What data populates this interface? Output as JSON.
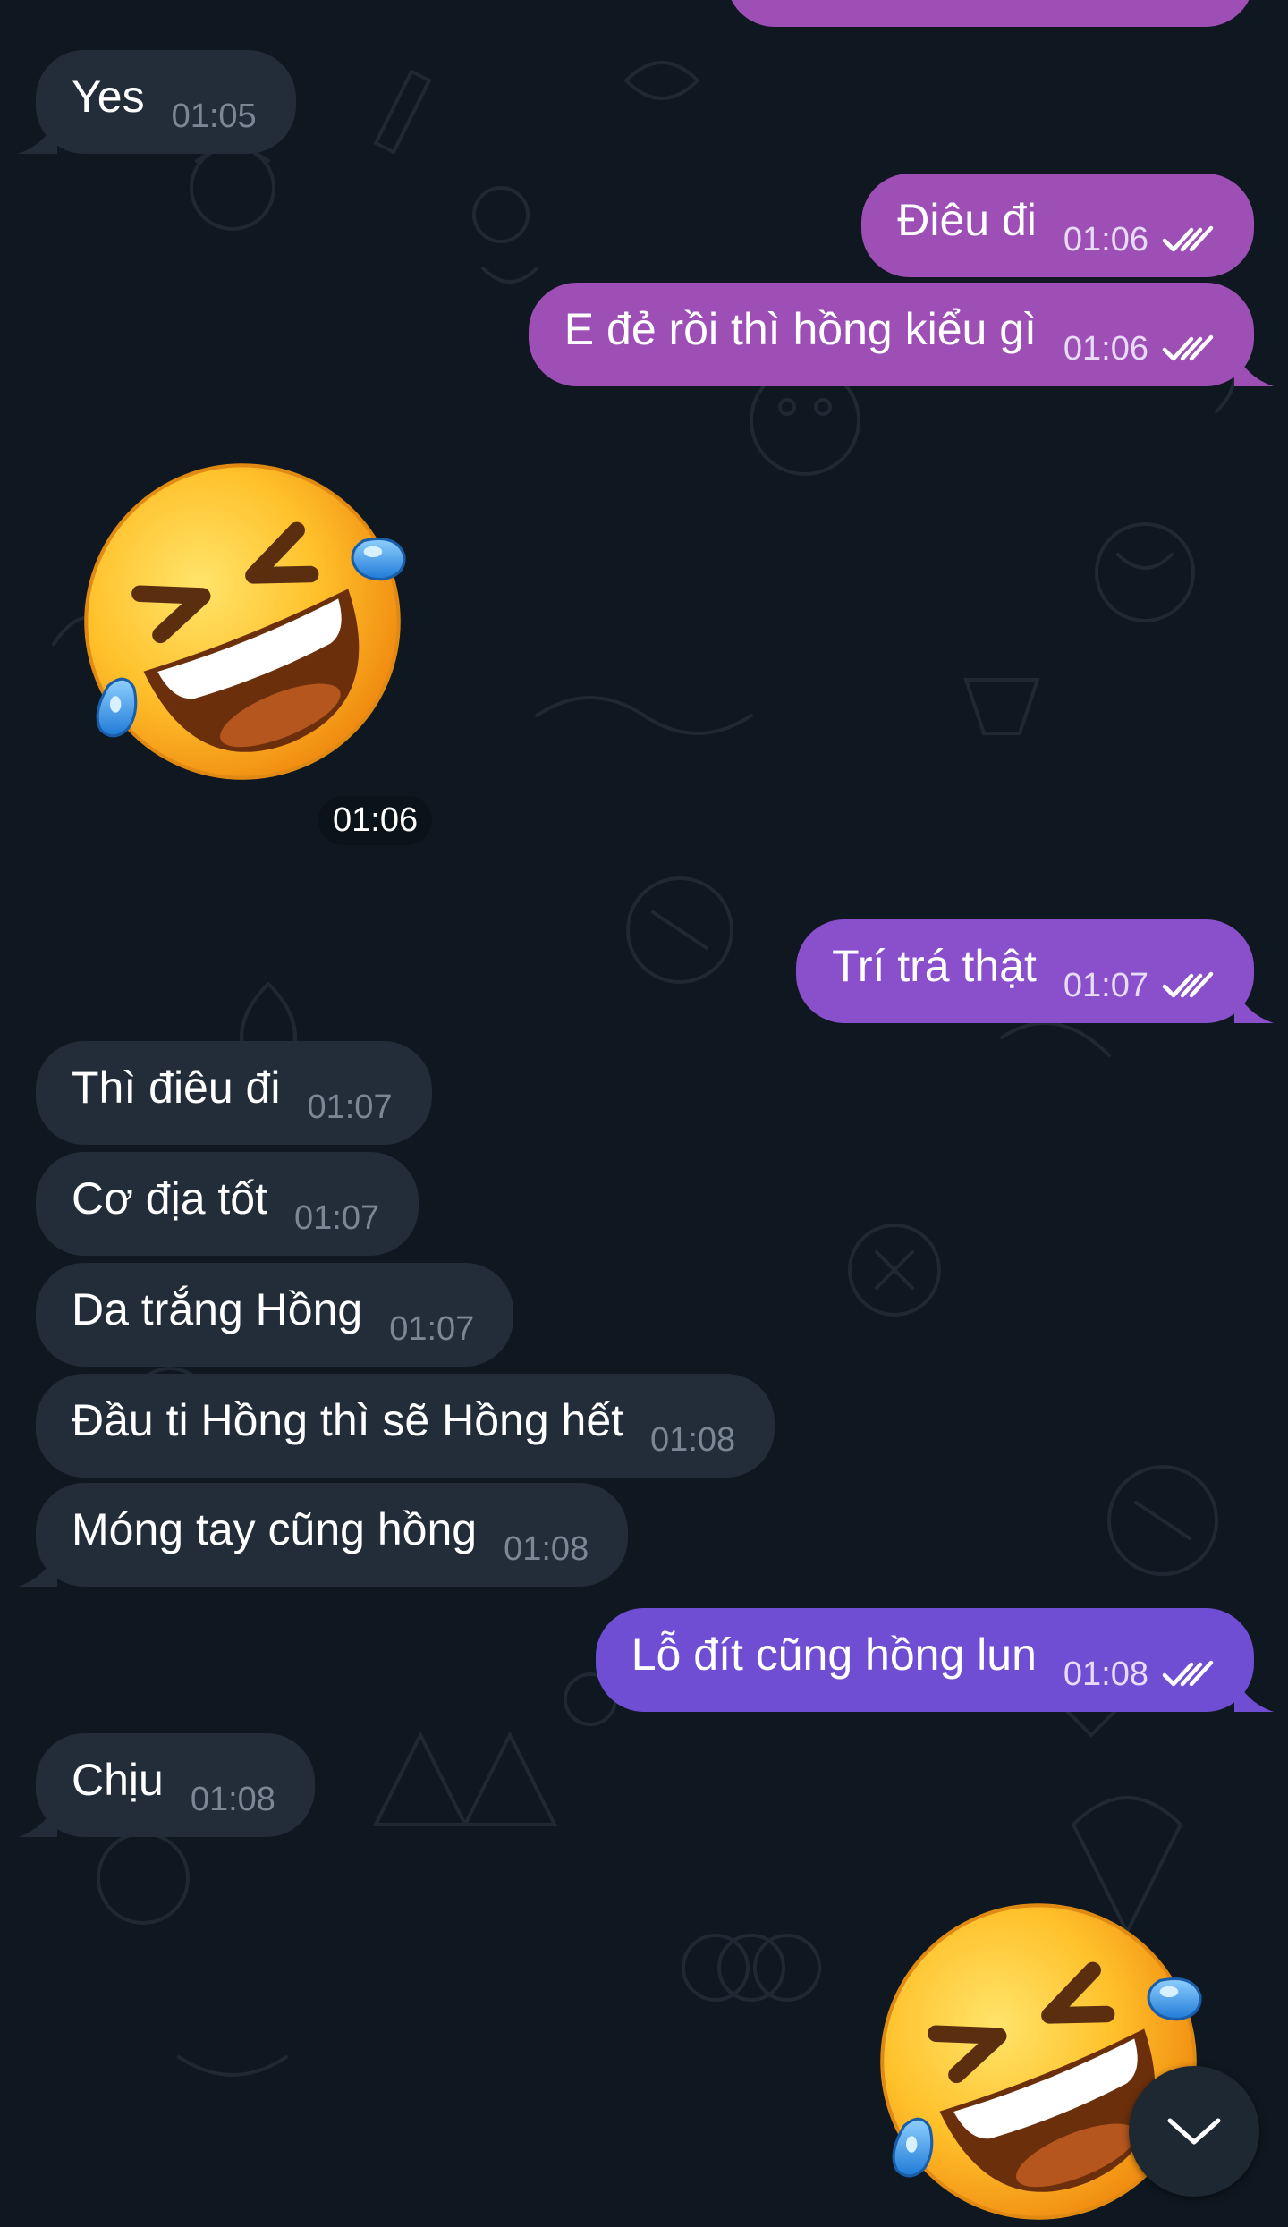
{
  "colors": {
    "background": "#0f1720",
    "incoming_bubble": "#222d39",
    "outgoing_pink": "#9d4fb6",
    "outgoing_purple": "#8a4fcb",
    "outgoing_violet": "#6f4ed4"
  },
  "messages": [
    {
      "text": "Yes",
      "time": "01:05"
    },
    {
      "text": "Điêu đi",
      "time": "01:06"
    },
    {
      "text": "E đẻ rồi thì hồng kiểu gì",
      "time": "01:06"
    },
    {
      "sticker": "rolling-on-floor-laughing-emoji",
      "time": "01:06"
    },
    {
      "text": "Trí trá thật",
      "time": "01:07"
    },
    {
      "text": "Thì điêu đi",
      "time": "01:07"
    },
    {
      "text": "Cơ địa tốt",
      "time": "01:07"
    },
    {
      "text": "Da trắng Hồng",
      "time": "01:07"
    },
    {
      "text": "Đầu ti Hồng thì sẽ Hồng hết",
      "time": "01:08"
    },
    {
      "text": "Móng tay cũng hồng",
      "time": "01:08"
    },
    {
      "text": "Lỗ đít cũng hồng lun",
      "time": "01:08"
    },
    {
      "text": "Chịu",
      "time": "01:08"
    },
    {
      "sticker": "rolling-on-floor-laughing-emoji"
    }
  ],
  "icons": {
    "read_receipt": "double-check-icon",
    "scroll_down": "chevron-down-icon"
  }
}
